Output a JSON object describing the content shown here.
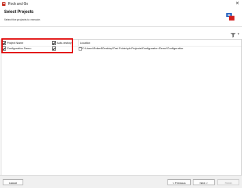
{
  "window": {
    "title": "Rock and Go"
  },
  "header": {
    "title": "Select Projects",
    "subtitle": "Select the projects to execute."
  },
  "grid": {
    "columns": [
      {
        "label": "Project Name"
      },
      {
        "label": "Auto-restory"
      },
      {
        "label": "Location"
      }
    ],
    "rows": [
      {
        "name": "Configuration Demo",
        "project_checked": true,
        "autorestore_checked": true,
        "location": "C:\\Users\\Robert\\Desktop\\Test Folder\\ptr Projects\\Configuration Demo\\Configuration"
      }
    ]
  },
  "footer": {
    "cancel": "Cancel",
    "previous": "< Previous",
    "next": "Next >",
    "finish": "Finish"
  },
  "colors": {
    "highlight": "#e00000",
    "logo_blue": "#1f5fbf",
    "logo_red": "#d21e1e"
  }
}
